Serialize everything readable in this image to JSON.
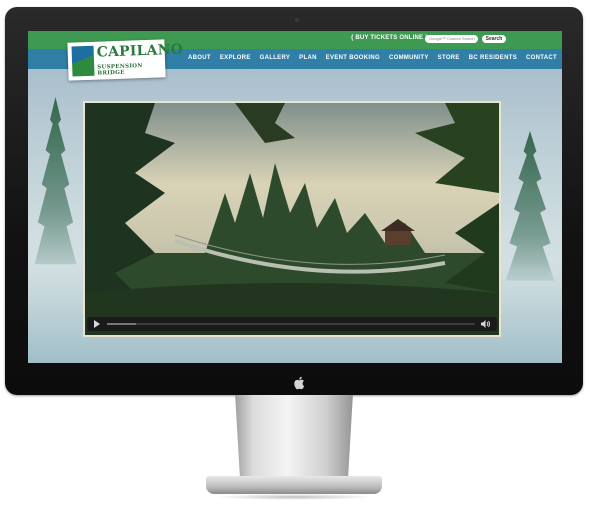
{
  "site": {
    "logo_name": "CAPILANO",
    "logo_sub": "SUSPENSION BRIDGE"
  },
  "top_bar": {
    "buy_tickets": "{ BUY TICKETS ONLINE }",
    "search_placeholder": "Google™ Custom Search",
    "search_button": "Search"
  },
  "nav": {
    "items": [
      "ABOUT",
      "EXPLORE",
      "GALLERY",
      "PLAN",
      "EVENT BOOKING",
      "COMMUNITY",
      "STORE",
      "BC RESIDENTS",
      "CONTACT"
    ]
  },
  "video": {
    "progress": 0.08
  },
  "colors": {
    "top_bar": "#3e9a52",
    "nav_bar": "#2f7fa7",
    "logo_green": "#2a7a3a",
    "bezel": "#121212"
  },
  "icons": {
    "apple": "apple-logo-icon",
    "play": "play-icon",
    "volume": "volume-icon"
  }
}
